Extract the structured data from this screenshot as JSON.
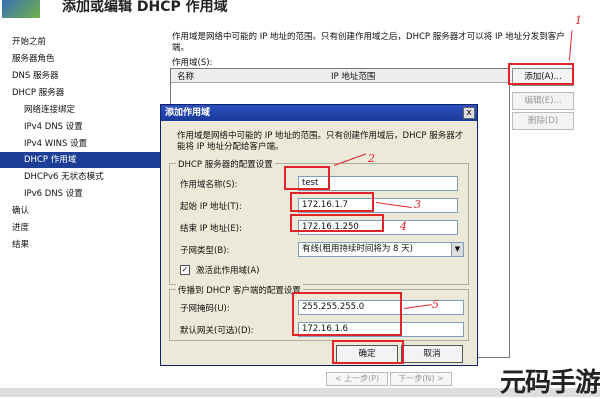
{
  "window": {
    "title": "添加或编辑 DHCP 作用域"
  },
  "nav": {
    "items": [
      {
        "label": "开始之前"
      },
      {
        "label": "服务器角色"
      },
      {
        "label": "DNS 服务器"
      },
      {
        "label": "DHCP 服务器"
      },
      {
        "label": "网络连接绑定"
      },
      {
        "label": "IPv4 DNS 设置"
      },
      {
        "label": "IPv4 WINS 设置"
      },
      {
        "label": "DHCP 作用域"
      },
      {
        "label": "DHCPv6 无状态模式"
      },
      {
        "label": "IPv6 DNS 设置"
      },
      {
        "label": "确认"
      },
      {
        "label": "进度"
      },
      {
        "label": "结果"
      }
    ]
  },
  "content": {
    "description": "作用域是网络中可能的 IP 地址的范围。只有创建作用域之后，DHCP 服务器才可以将 IP 地址分发到客户端。",
    "scopes_label": "作用域(S):",
    "columns": [
      "名称",
      "IP 地址范围"
    ],
    "buttons": {
      "add": "添加(A)...",
      "edit": "编辑(E)...",
      "delete": "删除(D)"
    }
  },
  "dialog": {
    "title": "添加作用域",
    "close": "x",
    "description": "作用域是网络中可能的 IP 地址的范围。只有创建作用域后，DHCP 服务器才能将 IP 地址分配给客户端。",
    "group1_title": "DHCP 服务器的配置设置",
    "scope_name_label": "作用域名称(S):",
    "scope_name_value": "test",
    "start_ip_label": "起始 IP 地址(T):",
    "start_ip_value": "172.16.1.7",
    "end_ip_label": "结束 IP 地址(E):",
    "end_ip_value": "172.16.1.250",
    "subnet_type_label": "子网类型(B):",
    "subnet_type_value": "有线(租用持续时间将为 8 天)",
    "activate_label": "激活此作用域(A)",
    "activate_checked": "✓",
    "group2_title": "传播到 DHCP 客户端的配置设置",
    "mask_label": "子网掩码(U):",
    "mask_value": "255.255.255.0",
    "gateway_label": "默认网关(可选)(D):",
    "gateway_value": "172.16.1.6",
    "ok": "确定",
    "cancel": "取消"
  },
  "wizard": {
    "prev": "< 上一步(P)",
    "next": "下一步(N) >"
  },
  "annotations": [
    "1",
    "2",
    "3",
    "4",
    "5"
  ],
  "watermark": "元码手游网",
  "colors": {
    "highlight": "#e0242a",
    "nav_selected": "#1c3f95",
    "dialog_title": "#2c4fbf"
  }
}
